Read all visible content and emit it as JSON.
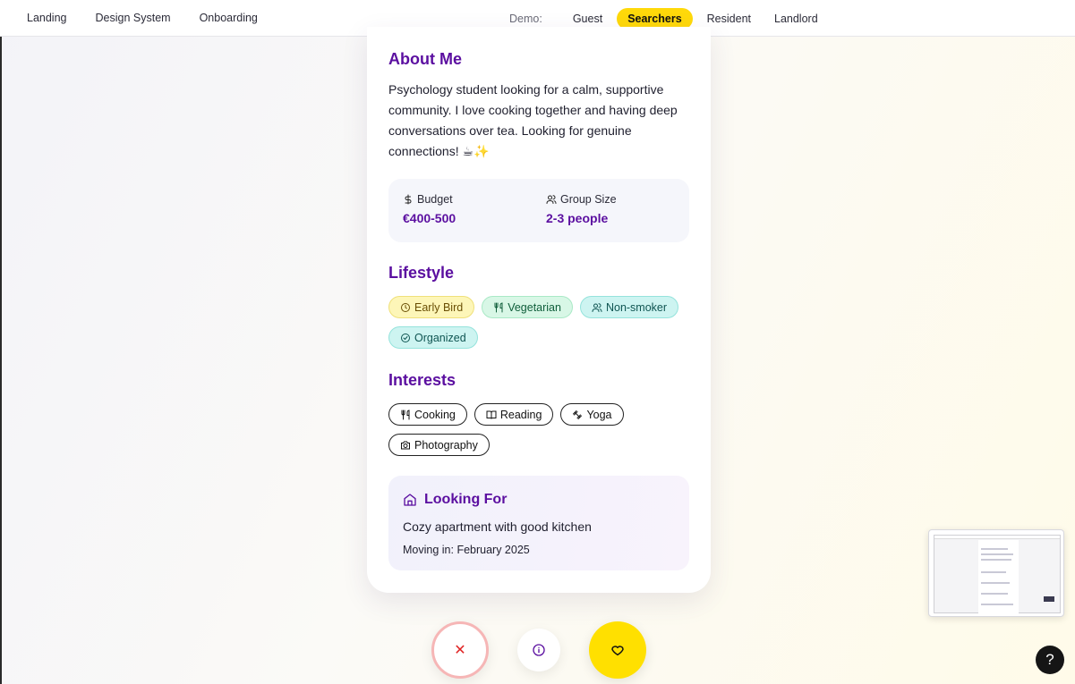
{
  "topnav": {
    "links": [
      "Landing",
      "Design System",
      "Onboarding"
    ],
    "demo_label": "Demo:",
    "demo_options": [
      "Guest",
      "Searchers",
      "Resident",
      "Landlord"
    ],
    "demo_active": "Searchers"
  },
  "profile": {
    "about": {
      "title": "About Me",
      "text": "Psychology student looking for a calm, supportive community. I love cooking together and having deep conversations over tea. Looking for genuine connections! ☕✨"
    },
    "stats": {
      "budget_label": "Budget",
      "budget_value": "€400-500",
      "group_label": "Group Size",
      "group_value": "2-3 people"
    },
    "lifestyle": {
      "title": "Lifestyle",
      "tags": [
        {
          "label": "Early Bird",
          "icon": "clock-icon",
          "color": "#fdf6b8"
        },
        {
          "label": "Vegetarian",
          "icon": "utensils-icon",
          "color": "#d8f7e6"
        },
        {
          "label": "Non-smoker",
          "icon": "users-icon",
          "color": "#cdf4f1"
        },
        {
          "label": "Organized",
          "icon": "check-circle-icon",
          "color": "#cdf4f1"
        }
      ]
    },
    "interests": {
      "title": "Interests",
      "tags": [
        {
          "label": "Cooking",
          "icon": "utensils-icon"
        },
        {
          "label": "Reading",
          "icon": "book-icon"
        },
        {
          "label": "Yoga",
          "icon": "dumbbell-icon"
        },
        {
          "label": "Photography",
          "icon": "camera-icon"
        }
      ]
    },
    "looking_for": {
      "title": "Looking For",
      "description": "Cozy apartment with good kitchen",
      "move_in": "Moving in: February 2025"
    }
  },
  "actions": {
    "pass_symbol": "✕",
    "help_symbol": "?"
  },
  "colors": {
    "accent_purple": "#5b0fa0",
    "accent_yellow": "#ffd90a",
    "pass_red": "#e02424"
  }
}
